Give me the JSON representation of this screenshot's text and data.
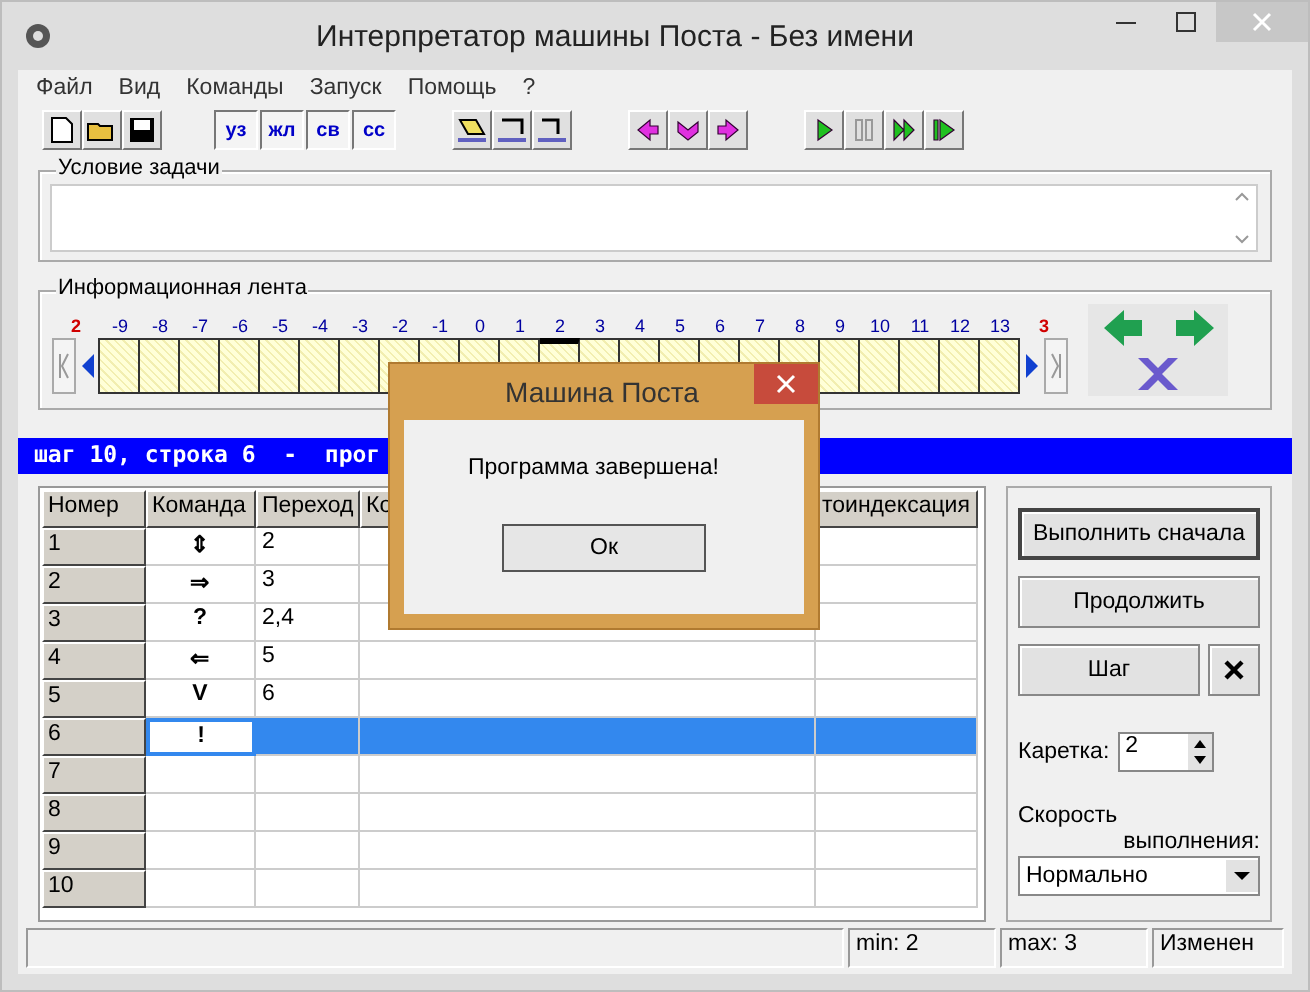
{
  "window": {
    "title": "Интерпретатор машины Поста  - Без имени"
  },
  "menu": [
    "Файл",
    "Вид",
    "Команды",
    "Запуск",
    "Помощь",
    "?"
  ],
  "toolbar": {
    "text_buttons": [
      "уз",
      "жл",
      "св",
      "сс"
    ]
  },
  "task_condition": {
    "label": "Условие задачи"
  },
  "tape": {
    "label": "Информационная лента",
    "left_bound": "2",
    "right_bound": "3",
    "positions": [
      {
        "label": "-9",
        "selected": false
      },
      {
        "label": "-8",
        "selected": false
      },
      {
        "label": "-7",
        "selected": false
      },
      {
        "label": "-6",
        "selected": false
      },
      {
        "label": "-5",
        "selected": false
      },
      {
        "label": "-4",
        "selected": false
      },
      {
        "label": "-3",
        "selected": false
      },
      {
        "label": "-2",
        "selected": false
      },
      {
        "label": "-1",
        "selected": false
      },
      {
        "label": "0",
        "selected": false
      },
      {
        "label": "1",
        "selected": false
      },
      {
        "label": "2",
        "selected": true
      },
      {
        "label": "3",
        "selected": false
      },
      {
        "label": "4",
        "selected": false
      },
      {
        "label": "5",
        "selected": false
      },
      {
        "label": "6",
        "selected": false
      },
      {
        "label": "7",
        "selected": false
      },
      {
        "label": "8",
        "selected": false
      },
      {
        "label": "9",
        "selected": false
      },
      {
        "label": "10",
        "selected": false
      },
      {
        "label": "11",
        "selected": false
      },
      {
        "label": "12",
        "selected": false
      },
      {
        "label": "13",
        "selected": false
      }
    ]
  },
  "status_line": "шаг 10, строка 6  -  прог",
  "program": {
    "columns": [
      "Номер",
      "Команда",
      "Переход",
      "Ко",
      "тоиндексация"
    ],
    "rows": [
      {
        "number": "1",
        "command": "⇕",
        "jump": "2",
        "selected": false
      },
      {
        "number": "2",
        "command": "⇒",
        "jump": "3",
        "selected": false
      },
      {
        "number": "3",
        "command": "?",
        "jump": "2,4",
        "selected": false
      },
      {
        "number": "4",
        "command": "⇐",
        "jump": "5",
        "selected": false
      },
      {
        "number": "5",
        "command": "V",
        "jump": "6",
        "selected": false
      },
      {
        "number": "6",
        "command": "!",
        "selected": true
      },
      {
        "number": "7",
        "selected": false
      },
      {
        "number": "8",
        "selected": false
      },
      {
        "number": "9",
        "selected": false
      },
      {
        "number": "10",
        "selected": false
      }
    ]
  },
  "controls": {
    "run_button": "Выполнить сначала",
    "continue_button": "Продолжить",
    "step_button": "Шаг",
    "caret_label": "Каретка:",
    "caret_value": "2",
    "speed_label": [
      "Скорость",
      "выполнения:"
    ],
    "speed": "Нормально"
  },
  "status_bar": [
    "min: 2",
    "max: 3",
    "Изменен"
  ],
  "dialog": {
    "title": "Машина Поста",
    "message": "Программа завершена!",
    "button": "Ок"
  }
}
